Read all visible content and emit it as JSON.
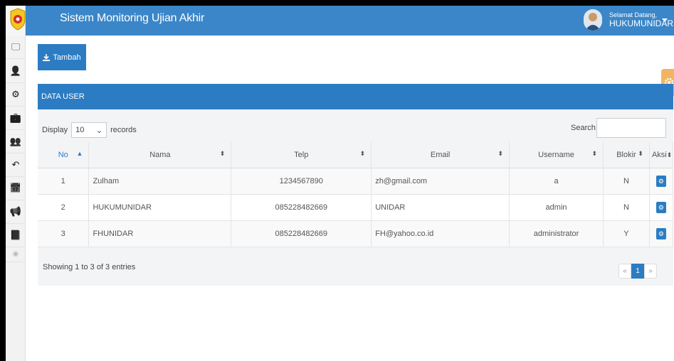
{
  "app": {
    "title": "Sistem Monitoring Ujian Akhir"
  },
  "user": {
    "welcome": "Selamat Datang,",
    "name": "HUKUMUNIDAR"
  },
  "sidebar": {
    "items": [
      {
        "icon": "desktop-icon",
        "glyph": "🖵"
      },
      {
        "icon": "user-icon",
        "glyph": "👤"
      },
      {
        "icon": "gear-icon",
        "glyph": "⚙"
      },
      {
        "icon": "briefcase-icon",
        "glyph": "💼"
      },
      {
        "icon": "users-icon",
        "glyph": "👥"
      },
      {
        "icon": "reply-icon",
        "glyph": "↶"
      },
      {
        "icon": "calendar-icon",
        "glyph": "📅"
      },
      {
        "icon": "bullhorn-icon",
        "glyph": "📢"
      },
      {
        "icon": "book-icon",
        "glyph": "📘"
      },
      {
        "icon": "collapse-icon",
        "glyph": "◉"
      }
    ]
  },
  "toolbar": {
    "add_label": "Tambah"
  },
  "panel": {
    "title": "DATA USER"
  },
  "table_controls": {
    "display_label": "Display",
    "length_value": "10",
    "records_label": "records",
    "search_label": "Search:",
    "search_value": ""
  },
  "table": {
    "columns": [
      "No",
      "Nama",
      "Telp",
      "Email",
      "Username",
      "Blokir",
      "Aksi"
    ],
    "rows": [
      {
        "no": "1",
        "nama": "Zulham",
        "telp": "1234567890",
        "email": "zh@gmail.com",
        "username": "a",
        "blokir": "N"
      },
      {
        "no": "2",
        "nama": "HUKUMUNIDAR",
        "telp": "085228482669",
        "email": "UNIDAR",
        "username": "admin",
        "blokir": "N"
      },
      {
        "no": "3",
        "nama": "FHUNIDAR",
        "telp": "085228482669",
        "email": "FH@yahoo.co.id",
        "username": "administrator",
        "blokir": "Y"
      }
    ]
  },
  "footer": {
    "info": "Showing 1 to 3 of 3 entries"
  },
  "pagination": {
    "prev": "«",
    "current": "1",
    "next": "»"
  },
  "colors": {
    "primary": "#2c7cc3",
    "navbar": "#3a86c8",
    "accent_tab": "#f0b563"
  }
}
